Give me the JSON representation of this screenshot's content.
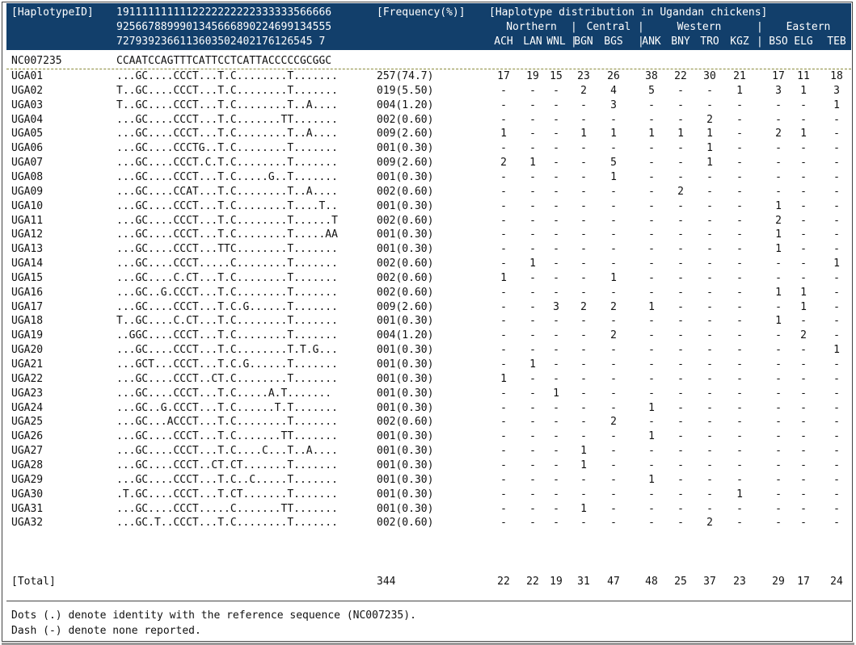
{
  "header": {
    "line1_id": "[HaplotypeID]",
    "pos_line1": "1911111111112222222222333333566666",
    "pos_line2": "9256678899901345666890224699134555",
    "pos_line3": "7279392366113603502402176126545 7",
    "freq_label": "[Frequency(%)]",
    "dist_label": "[Haplotype distribution in Ugandan chickens]",
    "regions": [
      {
        "name": "Northern",
        "pops": [
          "ACH",
          "LAN",
          "WNL"
        ]
      },
      {
        "name": "Central",
        "pops": [
          "BGN",
          "BGS"
        ]
      },
      {
        "name": "Western",
        "pops": [
          "ANK",
          "BNY",
          "TRO",
          "KGZ"
        ]
      },
      {
        "name": "Eastern",
        "pops": [
          "BSO",
          "ELG",
          "TEB"
        ]
      }
    ]
  },
  "reference": {
    "id": "NC007235",
    "sequence": "CCAATCCAGTTTCATTCCTCATTACCCCCGCGGC"
  },
  "rows": [
    {
      "id": "UGA01",
      "seq": "...GC....CCCT...T.C........T.......",
      "freq": "257(74.7)",
      "vals": [
        "17",
        "19",
        "15",
        "23",
        "26",
        "38",
        "22",
        "30",
        "21",
        "17",
        "11",
        "18"
      ]
    },
    {
      "id": "UGA02",
      "seq": "T..GC....CCCT...T.C........T.......",
      "freq": "019(5.50)",
      "vals": [
        "-",
        "-",
        "-",
        "2",
        "4",
        "5",
        "-",
        "-",
        "1",
        "3",
        "1",
        "3"
      ]
    },
    {
      "id": "UGA03",
      "seq": "T..GC....CCCT...T.C........T..A....",
      "freq": "004(1.20)",
      "vals": [
        "-",
        "-",
        "-",
        "-",
        "3",
        "-",
        "-",
        "-",
        "-",
        "-",
        "-",
        "1"
      ]
    },
    {
      "id": "UGA04",
      "seq": "...GC....CCCT...T.C.......TT.......",
      "freq": "002(0.60)",
      "vals": [
        "-",
        "-",
        "-",
        "-",
        "-",
        "-",
        "-",
        "2",
        "-",
        "-",
        "-",
        "-"
      ]
    },
    {
      "id": "UGA05",
      "seq": "...GC....CCCT...T.C........T..A....",
      "freq": "009(2.60)",
      "vals": [
        "1",
        "-",
        "-",
        "1",
        "1",
        "1",
        "1",
        "1",
        "-",
        "2",
        "1",
        "-"
      ]
    },
    {
      "id": "UGA06",
      "seq": "...GC....CCCTG..T.C........T.......",
      "freq": "001(0.30)",
      "vals": [
        "-",
        "-",
        "-",
        "-",
        "-",
        "-",
        "-",
        "1",
        "-",
        "-",
        "-",
        "-"
      ]
    },
    {
      "id": "UGA07",
      "seq": "...GC....CCCT.C.T.C........T.......",
      "freq": "009(2.60)",
      "vals": [
        "2",
        "1",
        "-",
        "-",
        "5",
        "-",
        "-",
        "1",
        "-",
        "-",
        "-",
        "-"
      ]
    },
    {
      "id": "UGA08",
      "seq": "...GC....CCCT...T.C.....G..T.......",
      "freq": "001(0.30)",
      "vals": [
        "-",
        "-",
        "-",
        "-",
        "1",
        "-",
        "-",
        "-",
        "-",
        "-",
        "-",
        "-"
      ]
    },
    {
      "id": "UGA09",
      "seq": "...GC....CCAT...T.C........T..A....",
      "freq": "002(0.60)",
      "vals": [
        "-",
        "-",
        "-",
        "-",
        "-",
        "-",
        "2",
        "-",
        "-",
        "-",
        "-",
        "-"
      ]
    },
    {
      "id": "UGA10",
      "seq": "...GC....CCCT...T.C........T....T..",
      "freq": "001(0.30)",
      "vals": [
        "-",
        "-",
        "-",
        "-",
        "-",
        "-",
        "-",
        "-",
        "-",
        "1",
        "-",
        "-"
      ]
    },
    {
      "id": "UGA11",
      "seq": "...GC....CCCT...T.C........T......T",
      "freq": "002(0.60)",
      "vals": [
        "-",
        "-",
        "-",
        "-",
        "-",
        "-",
        "-",
        "-",
        "-",
        "2",
        "-",
        "-"
      ]
    },
    {
      "id": "UGA12",
      "seq": "...GC....CCCT...T.C........T.....AA",
      "freq": "001(0.30)",
      "vals": [
        "-",
        "-",
        "-",
        "-",
        "-",
        "-",
        "-",
        "-",
        "-",
        "1",
        "-",
        "-"
      ]
    },
    {
      "id": "UGA13",
      "seq": "...GC....CCCT...TTC........T.......",
      "freq": "001(0.30)",
      "vals": [
        "-",
        "-",
        "-",
        "-",
        "-",
        "-",
        "-",
        "-",
        "-",
        "1",
        "-",
        "-"
      ]
    },
    {
      "id": "UGA14",
      "seq": "...GC....CCCT.....C........T.......",
      "freq": "002(0.60)",
      "vals": [
        "-",
        "1",
        "-",
        "-",
        "-",
        "-",
        "-",
        "-",
        "-",
        "-",
        "-",
        "1"
      ]
    },
    {
      "id": "UGA15",
      "seq": "...GC....C.CT...T.C........T.......",
      "freq": "002(0.60)",
      "vals": [
        "1",
        "-",
        "-",
        "-",
        "1",
        "-",
        "-",
        "-",
        "-",
        "-",
        "-",
        "-"
      ]
    },
    {
      "id": "UGA16",
      "seq": "...GC..G.CCCT...T.C........T.......",
      "freq": "002(0.60)",
      "vals": [
        "-",
        "-",
        "-",
        "-",
        "-",
        "-",
        "-",
        "-",
        "-",
        "1",
        "1",
        "-"
      ]
    },
    {
      "id": "UGA17",
      "seq": "...GC....CCCT...T.C.G......T.......",
      "freq": "009(2.60)",
      "vals": [
        "-",
        "-",
        "3",
        "2",
        "2",
        "1",
        "-",
        "-",
        "-",
        "-",
        "1",
        "-"
      ]
    },
    {
      "id": "UGA18",
      "seq": "T..GC....C.CT...T.C........T.......",
      "freq": "001(0.30)",
      "vals": [
        "-",
        "-",
        "-",
        "-",
        "-",
        "-",
        "-",
        "-",
        "-",
        "1",
        "-",
        "-"
      ]
    },
    {
      "id": "UGA19",
      "seq": "..GGC....CCCT...T.C........T.......",
      "freq": "004(1.20)",
      "vals": [
        "-",
        "-",
        "-",
        "-",
        "2",
        "-",
        "-",
        "-",
        "-",
        "-",
        "2",
        "-"
      ]
    },
    {
      "id": "UGA20",
      "seq": "...GC....CCCT...T.C........T.T.G...",
      "freq": "001(0.30)",
      "vals": [
        "-",
        "-",
        "-",
        "-",
        "-",
        "-",
        "-",
        "-",
        "-",
        "-",
        "-",
        "1"
      ]
    },
    {
      "id": "UGA21",
      "seq": "...GCT...CCCT...T.C.G......T.......",
      "freq": "001(0.30)",
      "vals": [
        "-",
        "1",
        "-",
        "-",
        "-",
        "-",
        "-",
        "-",
        "-",
        "-",
        "-",
        "-"
      ]
    },
    {
      "id": "UGA22",
      "seq": "...GC....CCCT..CT.C........T.......",
      "freq": "001(0.30)",
      "vals": [
        "1",
        "-",
        "-",
        "-",
        "-",
        "-",
        "-",
        "-",
        "-",
        "-",
        "-",
        "-"
      ]
    },
    {
      "id": "UGA23",
      "seq": "...GC....CCCT...T.C.....A.T.......",
      "freq": "001(0.30)",
      "vals": [
        "-",
        "-",
        "1",
        "-",
        "-",
        "-",
        "-",
        "-",
        "-",
        "-",
        "-",
        "-"
      ]
    },
    {
      "id": "UGA24",
      "seq": "...GC..G.CCCT...T.C......T.T.......",
      "freq": "001(0.30)",
      "vals": [
        "-",
        "-",
        "-",
        "-",
        "-",
        "1",
        "-",
        "-",
        "-",
        "-",
        "-",
        "-"
      ]
    },
    {
      "id": "UGA25",
      "seq": "...GC...ACCCT...T.C........T.......",
      "freq": "002(0.60)",
      "vals": [
        "-",
        "-",
        "-",
        "-",
        "2",
        "-",
        "-",
        "-",
        "-",
        "-",
        "-",
        "-"
      ]
    },
    {
      "id": "UGA26",
      "seq": "...GC....CCCT...T.C.......TT.......",
      "freq": "001(0.30)",
      "vals": [
        "-",
        "-",
        "-",
        "-",
        "-",
        "1",
        "-",
        "-",
        "-",
        "-",
        "-",
        "-"
      ]
    },
    {
      "id": "UGA27",
      "seq": "...GC....CCCT...T.C....C...T..A....",
      "freq": "001(0.30)",
      "vals": [
        "-",
        "-",
        "-",
        "1",
        "-",
        "-",
        "-",
        "-",
        "-",
        "-",
        "-",
        "-"
      ]
    },
    {
      "id": "UGA28",
      "seq": "...GC....CCCT..CT.CT.......T.......",
      "freq": "001(0.30)",
      "vals": [
        "-",
        "-",
        "-",
        "1",
        "-",
        "-",
        "-",
        "-",
        "-",
        "-",
        "-",
        "-"
      ]
    },
    {
      "id": "UGA29",
      "seq": "...GC....CCCT...T.C..C.....T.......",
      "freq": "001(0.30)",
      "vals": [
        "-",
        "-",
        "-",
        "-",
        "-",
        "1",
        "-",
        "-",
        "-",
        "-",
        "-",
        "-"
      ]
    },
    {
      "id": "UGA30",
      "seq": ".T.GC....CCCT...T.CT.......T.......",
      "freq": "001(0.30)",
      "vals": [
        "-",
        "-",
        "-",
        "-",
        "-",
        "-",
        "-",
        "-",
        "1",
        "-",
        "-",
        "-"
      ]
    },
    {
      "id": "UGA31",
      "seq": "...GC....CCCT.....C.......TT.......",
      "freq": "001(0.30)",
      "vals": [
        "-",
        "-",
        "-",
        "1",
        "-",
        "-",
        "-",
        "-",
        "-",
        "-",
        "-",
        "-"
      ]
    },
    {
      "id": "UGA32",
      "seq": "...GC.T..CCCT...T.C........T.......",
      "freq": "002(0.60)",
      "vals": [
        "-",
        "-",
        "-",
        "-",
        "-",
        "-",
        "-",
        "2",
        "-",
        "-",
        "-",
        "-"
      ]
    }
  ],
  "total": {
    "label": "[Total]",
    "count": "344",
    "vals": [
      "22",
      "22",
      "19",
      "31",
      "47",
      "48",
      "25",
      "37",
      "23",
      "29",
      "17",
      "24"
    ]
  },
  "footnotes": {
    "line1": "Dots (.) denote identity with the reference sequence (NC007235).",
    "line2": "Dash (-) denote none reported."
  }
}
